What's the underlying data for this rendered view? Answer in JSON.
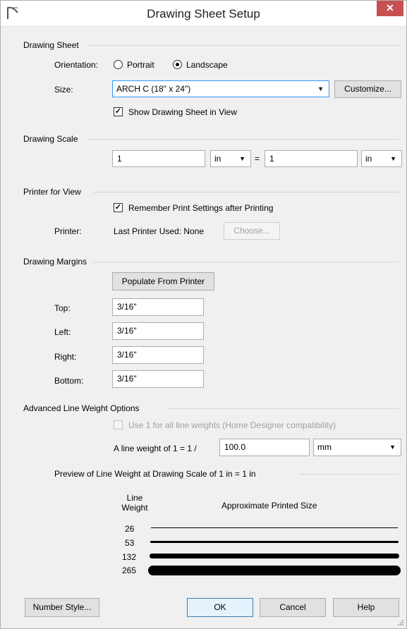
{
  "window": {
    "title": "Drawing Sheet Setup",
    "close_glyph": "✕"
  },
  "drawing_sheet": {
    "group_title": "Drawing Sheet",
    "orientation_label": "Orientation:",
    "portrait_label": "Portrait",
    "landscape_label": "Landscape",
    "size_label": "Size:",
    "size_value": "ARCH C  (18\" x 24\")",
    "customize_label": "Customize...",
    "show_sheet_label": "Show Drawing Sheet in View"
  },
  "drawing_scale": {
    "group_title": "Drawing Scale",
    "left_value": "1",
    "left_unit": "in",
    "equals": "=",
    "right_value": "1",
    "right_unit": "in"
  },
  "printer": {
    "group_title": "Printer for View",
    "remember_label": "Remember Print Settings after Printing",
    "printer_label": "Printer:",
    "printer_value": "Last Printer Used: None",
    "choose_label": "Choose..."
  },
  "margins": {
    "group_title": "Drawing Margins",
    "populate_label": "Populate From Printer",
    "top_label": "Top:",
    "top_value": "3/16\"",
    "left_label": "Left:",
    "left_value": "3/16\"",
    "right_label": "Right:",
    "right_value": "3/16\"",
    "bottom_label": "Bottom:",
    "bottom_value": "3/16\""
  },
  "advanced": {
    "group_title": "Advanced Line Weight Options",
    "use_one_label": "Use 1 for all line weights (Home Designer compatibility)",
    "line_weight_label": "A line weight of 1 = 1 /",
    "line_weight_value": "100.0",
    "unit_value": "mm",
    "preview_title": "Preview of Line Weight at Drawing Scale of  1 in = 1 in",
    "col_line": "Line",
    "col_weight": "Weight",
    "col_size": "Approximate Printed Size",
    "weights": [
      "26",
      "53",
      "132",
      "265"
    ]
  },
  "footer": {
    "number_style_label": "Number Style...",
    "ok_label": "OK",
    "cancel_label": "Cancel",
    "help_label": "Help"
  }
}
